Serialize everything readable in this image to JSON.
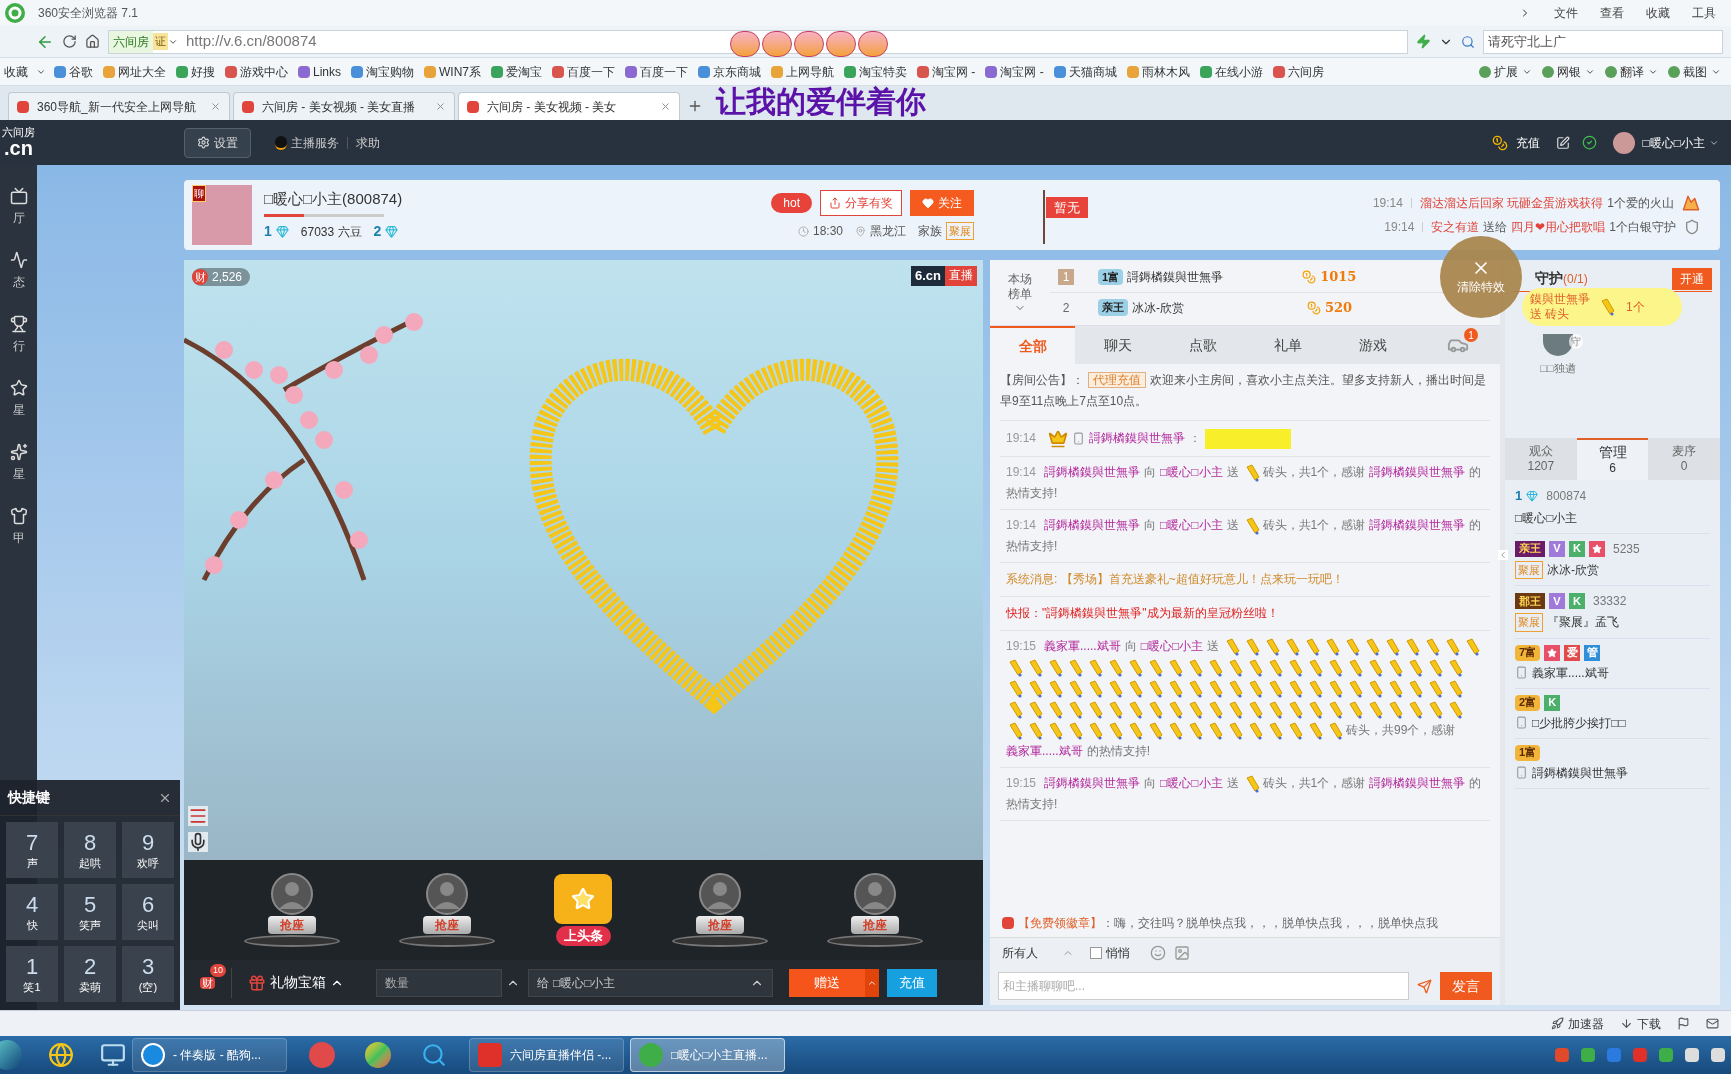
{
  "browser": {
    "title": "360安全浏览器 7.1",
    "menu": [
      "文件",
      "查看",
      "收藏",
      "工具"
    ],
    "site_badge": "六间房",
    "cert": "证",
    "url": "http://v.6.cn/800874",
    "search_placeholder": "请死守北上广",
    "bookmarks_label": "收藏",
    "bookmarks": [
      "谷歌",
      "网址大全",
      "好搜",
      "游戏中心",
      "Links",
      "淘宝购物",
      "WIN7系",
      "爱淘宝",
      "百度一下",
      "百度一下",
      "京东商城",
      "上网导航",
      "淘宝特卖",
      "淘宝网 -",
      "淘宝网 -",
      "天猫商城",
      "雨林木风",
      "在线小游",
      "六间房"
    ],
    "toolbar_right": [
      "扩展",
      "网银",
      "翻译",
      "截图"
    ],
    "tabs": [
      {
        "label": "360导航_新一代安全上网导航",
        "selected": false
      },
      {
        "label": "六间房 - 美女视频 - 美女直播",
        "selected": false
      },
      {
        "label": "六间房 - 美女视频 - 美女",
        "selected": true
      }
    ]
  },
  "gift_overlay": {
    "text": "让我的爱伴着你"
  },
  "site_header": {
    "logo_top": "六间房",
    "logo": ".cn",
    "settings": "设置",
    "links": [
      "主播服务",
      "求助"
    ],
    "recharge": "充值",
    "user": "□暖心□小主"
  },
  "sidebar": [
    "厅",
    "态",
    "行",
    "星",
    "星",
    "甲"
  ],
  "anchor": {
    "badge": "聊",
    "name": "□暖心□小主(800874)",
    "level": 0.33,
    "rank": "1",
    "beans": "67033 六豆",
    "rank2": "2",
    "hot": "hot",
    "share": "分享有奖",
    "follow": "关注",
    "time": "18:30",
    "location": "黑龙江",
    "family": "家族",
    "family_tag": "聚展"
  },
  "flag": "暂无",
  "news": [
    {
      "time": "19:14",
      "parts": [
        {
          "kind": "name",
          "text": "溜达溜达后回家 玩砸金蛋游戏获得"
        },
        {
          "kind": "text",
          "text": "1个爱的火山"
        }
      ]
    },
    {
      "time": "19:14",
      "parts": [
        {
          "kind": "name",
          "text": "安之有道"
        },
        {
          "kind": "text",
          "text": "送给"
        },
        {
          "kind": "name",
          "text": "四月❤用心把歌唱"
        },
        {
          "kind": "text",
          "text": "1个白银守护"
        }
      ]
    }
  ],
  "video": {
    "wealth_icon": "财",
    "wealth": "2,526",
    "brand": "6.cn",
    "live": "直播"
  },
  "seats": [
    {
      "kind": "seat",
      "label": "抢座"
    },
    {
      "kind": "seat",
      "label": "抢座"
    },
    {
      "kind": "headline",
      "label": "上头条"
    },
    {
      "kind": "seat",
      "label": "抢座"
    },
    {
      "kind": "seat",
      "label": "抢座"
    }
  ],
  "controls": {
    "wealth_icon": "财",
    "count": "10",
    "gift_box": "礼物宝箱",
    "quantity_placeholder": "数量",
    "to": "给",
    "recipient": "□暖心□小主",
    "send": "赠送",
    "recharge": "充值"
  },
  "quick_keys": {
    "title": "快捷键",
    "keys": [
      {
        "key": "7",
        "label": "声"
      },
      {
        "key": "8",
        "label": "起哄"
      },
      {
        "key": "9",
        "label": "欢呼"
      },
      {
        "key": "4",
        "label": "快"
      },
      {
        "key": "5",
        "label": "笑声"
      },
      {
        "key": "6",
        "label": "尖叫"
      },
      {
        "key": "1",
        "label": "笑1"
      },
      {
        "key": "2",
        "label": "卖萌"
      },
      {
        "key": "3",
        "label": "(空)"
      }
    ]
  },
  "ranking": {
    "label": [
      "本场",
      "榜单"
    ],
    "rows": [
      {
        "rank": "1",
        "badge": "1富",
        "name": "謌鎒橉鏌與世無爭",
        "score": "1015"
      },
      {
        "rank": "2",
        "badge": "亲王",
        "name": "冰冰-欣赏",
        "score": "520"
      }
    ]
  },
  "clear_effects": "清除特效",
  "gift_banner": {
    "name": "鏌與世無爭",
    "action": "送 砖头",
    "count": "1个"
  },
  "guard": {
    "title": "守护",
    "count": "(0/1)",
    "open": "开通",
    "member": "□□独遒",
    "member_badge": "守"
  },
  "chat_tabs": [
    {
      "label": "全部",
      "selected": true
    },
    {
      "label": "聊天",
      "selected": false
    },
    {
      "label": "点歌",
      "selected": false
    },
    {
      "label": "礼单",
      "selected": false
    },
    {
      "label": "游戏",
      "selected": false
    }
  ],
  "car_badge": "1",
  "messages": [
    {
      "kind": "notice",
      "label": "【房间公告】：",
      "tag": "代理充值",
      "text": "欢迎来小主房间，喜欢小主点关注。望多支持新人，播出时间是早9至11点晚上7点至10点。"
    },
    {
      "kind": "chat",
      "time": "19:14",
      "name": "謌鎒橉鏌與世無爭",
      "separator": "："
    },
    {
      "kind": "gift",
      "time": "19:14",
      "parts": [
        {
          "kind": "name",
          "text": "謌鎒橉鏌與世無爭"
        },
        {
          "kind": "text",
          "text": "向"
        },
        {
          "kind": "name",
          "text": "□暖心□小主"
        },
        {
          "kind": "text",
          "text": "送"
        },
        {
          "kind": "gift_icon"
        },
        {
          "kind": "text",
          "text": "砖头，共1个，感谢"
        },
        {
          "kind": "name",
          "text": "謌鎒橉鏌與世無爭"
        },
        {
          "kind": "text",
          "text": "的热情支持!"
        }
      ]
    },
    {
      "kind": "gift",
      "time": "19:14",
      "parts": [
        {
          "kind": "name",
          "text": "謌鎒橉鏌與世無爭"
        },
        {
          "kind": "text",
          "text": "向"
        },
        {
          "kind": "name",
          "text": "□暖心□小主"
        },
        {
          "kind": "text",
          "text": "送"
        },
        {
          "kind": "gift_icon"
        },
        {
          "kind": "text",
          "text": "砖头，共1个，感谢"
        },
        {
          "kind": "name",
          "text": "謌鎒橉鏌與世無爭"
        },
        {
          "kind": "text",
          "text": "的热情支持!"
        }
      ]
    },
    {
      "kind": "system",
      "text": "系统消息: 【秀场】首充送豪礼~超值好玩意儿！点来玩一玩吧！"
    },
    {
      "kind": "flash",
      "text": "快报：\"謌鎒橉鏌與世無爭\"成为最新的皇冠粉丝啦！"
    },
    {
      "kind": "gift",
      "time": "19:15",
      "parts": [
        {
          "kind": "name",
          "text": "義家軍.....斌哥"
        },
        {
          "kind": "text",
          "text": "向"
        },
        {
          "kind": "name",
          "text": "□暖心□小主"
        },
        {
          "kind": "text",
          "text": "送"
        },
        {
          "kind": "gift_icons"
        },
        {
          "kind": "text",
          "text": "砖头，共99个，感谢"
        },
        {
          "kind": "name",
          "text": "義家軍.....斌哥"
        },
        {
          "kind": "text",
          "text": "的热情支持!"
        }
      ]
    },
    {
      "kind": "gift",
      "time": "19:15",
      "parts": [
        {
          "kind": "name",
          "text": "謌鎒橉鏌與世無爭"
        },
        {
          "kind": "text",
          "text": "向"
        },
        {
          "kind": "name",
          "text": "□暖心□小主"
        },
        {
          "kind": "text",
          "text": "送"
        },
        {
          "kind": "gift_icon"
        },
        {
          "kind": "text",
          "text": "砖头，共1个，感谢"
        },
        {
          "kind": "name",
          "text": "謌鎒橉鏌與世無爭"
        },
        {
          "kind": "text",
          "text": "的热情支持!"
        }
      ]
    }
  ],
  "announcement": {
    "tag": "【免费领徽章】",
    "text": "：嗨，交往吗？脱单快点我，，，脱单快点我，，，脱单快点我"
  },
  "chat_input": {
    "target": "所有人",
    "whisper": "悄悄",
    "whisper_checked": false,
    "placeholder": "和主播聊聊吧...",
    "send": "发言"
  },
  "audience_tabs": [
    {
      "label": "观众",
      "count": "1207",
      "selected": false
    },
    {
      "label": "管理",
      "count": "6",
      "selected": true
    },
    {
      "label": "麦序",
      "count": "0",
      "selected": false
    }
  ],
  "members": [
    {
      "level": "1",
      "id": "800874",
      "name": "□暖心□小主",
      "mobile": false
    },
    {
      "badges": [
        {
          "kind": "noble",
          "text": "亲王"
        },
        {
          "kind": "vip",
          "text": "V"
        },
        {
          "kind": "k",
          "text": "K"
        },
        {
          "kind": "star"
        }
      ],
      "id": "5235",
      "tag": "聚展",
      "name": "冰冰-欣赏",
      "mobile": false
    },
    {
      "badges": [
        {
          "kind": "duke",
          "text": "郡王"
        },
        {
          "kind": "vip",
          "text": "V"
        },
        {
          "kind": "k",
          "text": "K"
        }
      ],
      "id": "33332",
      "tag": "聚展",
      "name": "『聚展』孟飞",
      "mobile": false
    },
    {
      "badges": [
        {
          "kind": "wealth",
          "text": "7富"
        },
        {
          "kind": "star"
        },
        {
          "kind": "love",
          "text": "爱"
        },
        {
          "kind": "admin",
          "text": "管"
        }
      ],
      "name": "義家軍.....斌哥",
      "mobile": true
    },
    {
      "badges": [
        {
          "kind": "wealth",
          "text": "2富"
        },
        {
          "kind": "k",
          "text": "K"
        }
      ],
      "name": "□少批胯少挨打□□",
      "mobile": true
    },
    {
      "badges": [
        {
          "kind": "wealth",
          "text": "1富"
        }
      ],
      "name": "謌鎒橉鏌與世無爭",
      "mobile": true
    }
  ],
  "status_bar": [
    "加速器",
    "下载"
  ],
  "taskbar": [
    {
      "kind": "music",
      "label": "- 伴奏版 - 酷狗...",
      "selected": false
    },
    {
      "kind": "six",
      "label": "六间房直播伴侣 -...",
      "selected": false
    },
    {
      "kind": "browser",
      "label": "□暖心□小主直播...",
      "selected": true
    }
  ]
}
